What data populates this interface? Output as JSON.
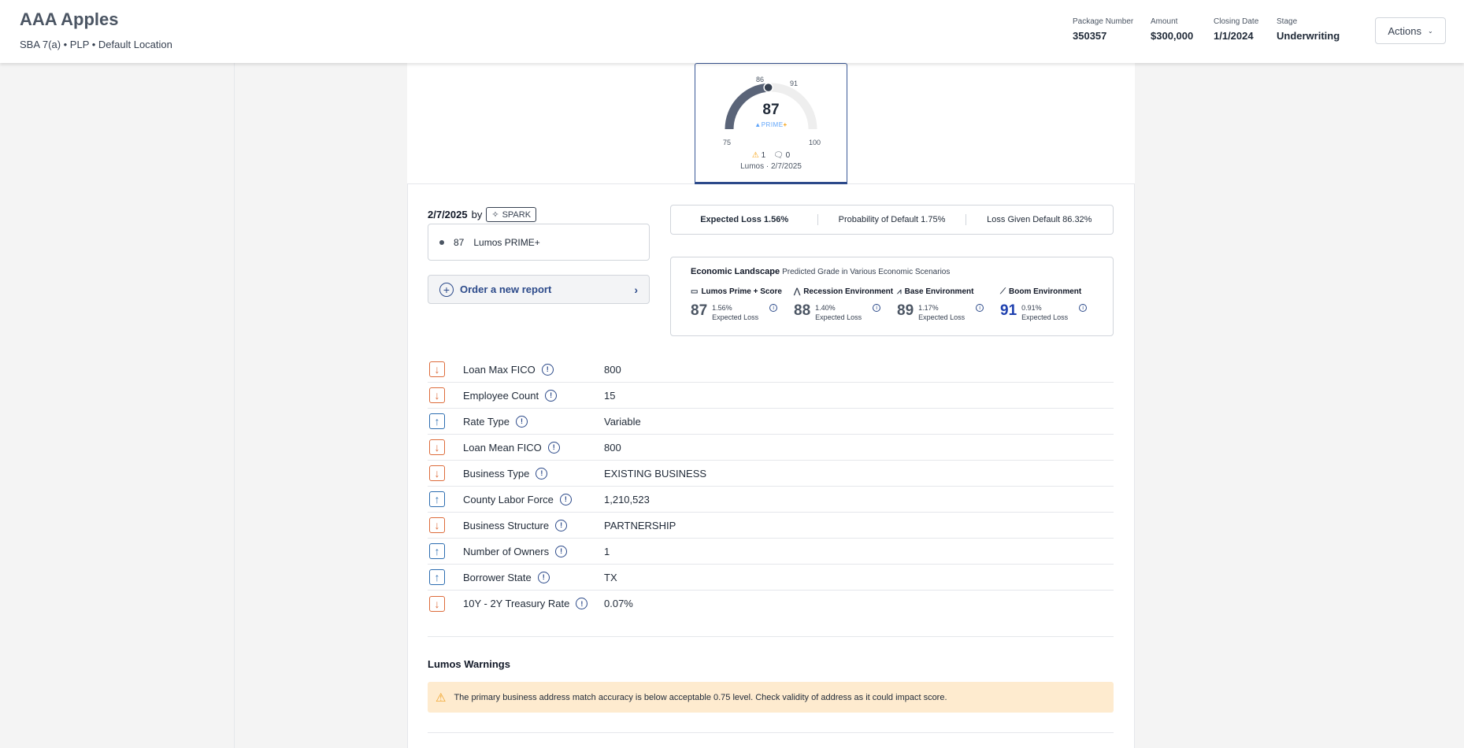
{
  "header": {
    "title": "AAA Apples",
    "subtitle": "SBA 7(a) • PLP • Default Location",
    "meta": [
      {
        "label": "Package Number",
        "value": "350357"
      },
      {
        "label": "Amount",
        "value": "$300,000"
      },
      {
        "label": "Closing Date",
        "value": "1/1/2024"
      },
      {
        "label": "Stage",
        "value": "Underwriting"
      }
    ],
    "actions_label": "Actions"
  },
  "gauge": {
    "score": "87",
    "score_value": 87,
    "min": "75",
    "max": "100",
    "mark_low": "86",
    "mark_high": "91",
    "brand": "PRIME",
    "brand_plus": "+",
    "warnings_count": "1",
    "comments_count": "0",
    "footer": "Lumos · 2/7/2025",
    "colors": {
      "fill": "#5a6478",
      "track": "#eeeeee",
      "accent": "#2c4a8a"
    }
  },
  "report": {
    "date": "2/7/2025",
    "by": "by",
    "badge": "SPARK",
    "list_score": "87",
    "list_name": "Lumos PRIME+",
    "order_label": "Order a new report"
  },
  "loss": {
    "expected": "Expected Loss 1.56%",
    "pd": "Probability of Default 1.75%",
    "lgd": "Loss Given Default 86.32%"
  },
  "economic": {
    "title": "Economic Landscape",
    "subtitle": "Predicted Grade in Various Economic Scenarios",
    "scenarios": [
      {
        "name": "Lumos Prime + Score",
        "icon": "calendar-icon",
        "grade": "87",
        "loss": "1.56%",
        "loss_label": "Expected Loss"
      },
      {
        "name": "Recession Environment",
        "icon": "trend-down-icon",
        "grade": "88",
        "loss": "1.40%",
        "loss_label": "Expected Loss"
      },
      {
        "name": "Base Environment",
        "icon": "trend-flat-icon",
        "grade": "89",
        "loss": "1.17%",
        "loss_label": "Expected Loss"
      },
      {
        "name": "Boom Environment",
        "icon": "trend-up-icon",
        "grade": "91",
        "loss": "0.91%",
        "loss_label": "Expected Loss"
      }
    ]
  },
  "factors": [
    {
      "direction": "down",
      "name": "Loan Max FICO",
      "value": "800"
    },
    {
      "direction": "down",
      "name": "Employee Count",
      "value": "15"
    },
    {
      "direction": "up",
      "name": "Rate Type",
      "value": "Variable"
    },
    {
      "direction": "down",
      "name": "Loan Mean FICO",
      "value": "800"
    },
    {
      "direction": "down",
      "name": "Business Type",
      "value": "EXISTING BUSINESS"
    },
    {
      "direction": "up",
      "name": "County Labor Force",
      "value": "1,210,523"
    },
    {
      "direction": "down",
      "name": "Business Structure",
      "value": "PARTNERSHIP"
    },
    {
      "direction": "up",
      "name": "Number of Owners",
      "value": "1"
    },
    {
      "direction": "up",
      "name": "Borrower State",
      "value": "TX"
    },
    {
      "direction": "down",
      "name": "10Y - 2Y Treasury Rate",
      "value": "0.07%"
    }
  ],
  "warnings": {
    "title": "Lumos Warnings",
    "message": "The primary business address match accuracy is below acceptable 0.75 level. Check validity of address as it could impact score."
  }
}
